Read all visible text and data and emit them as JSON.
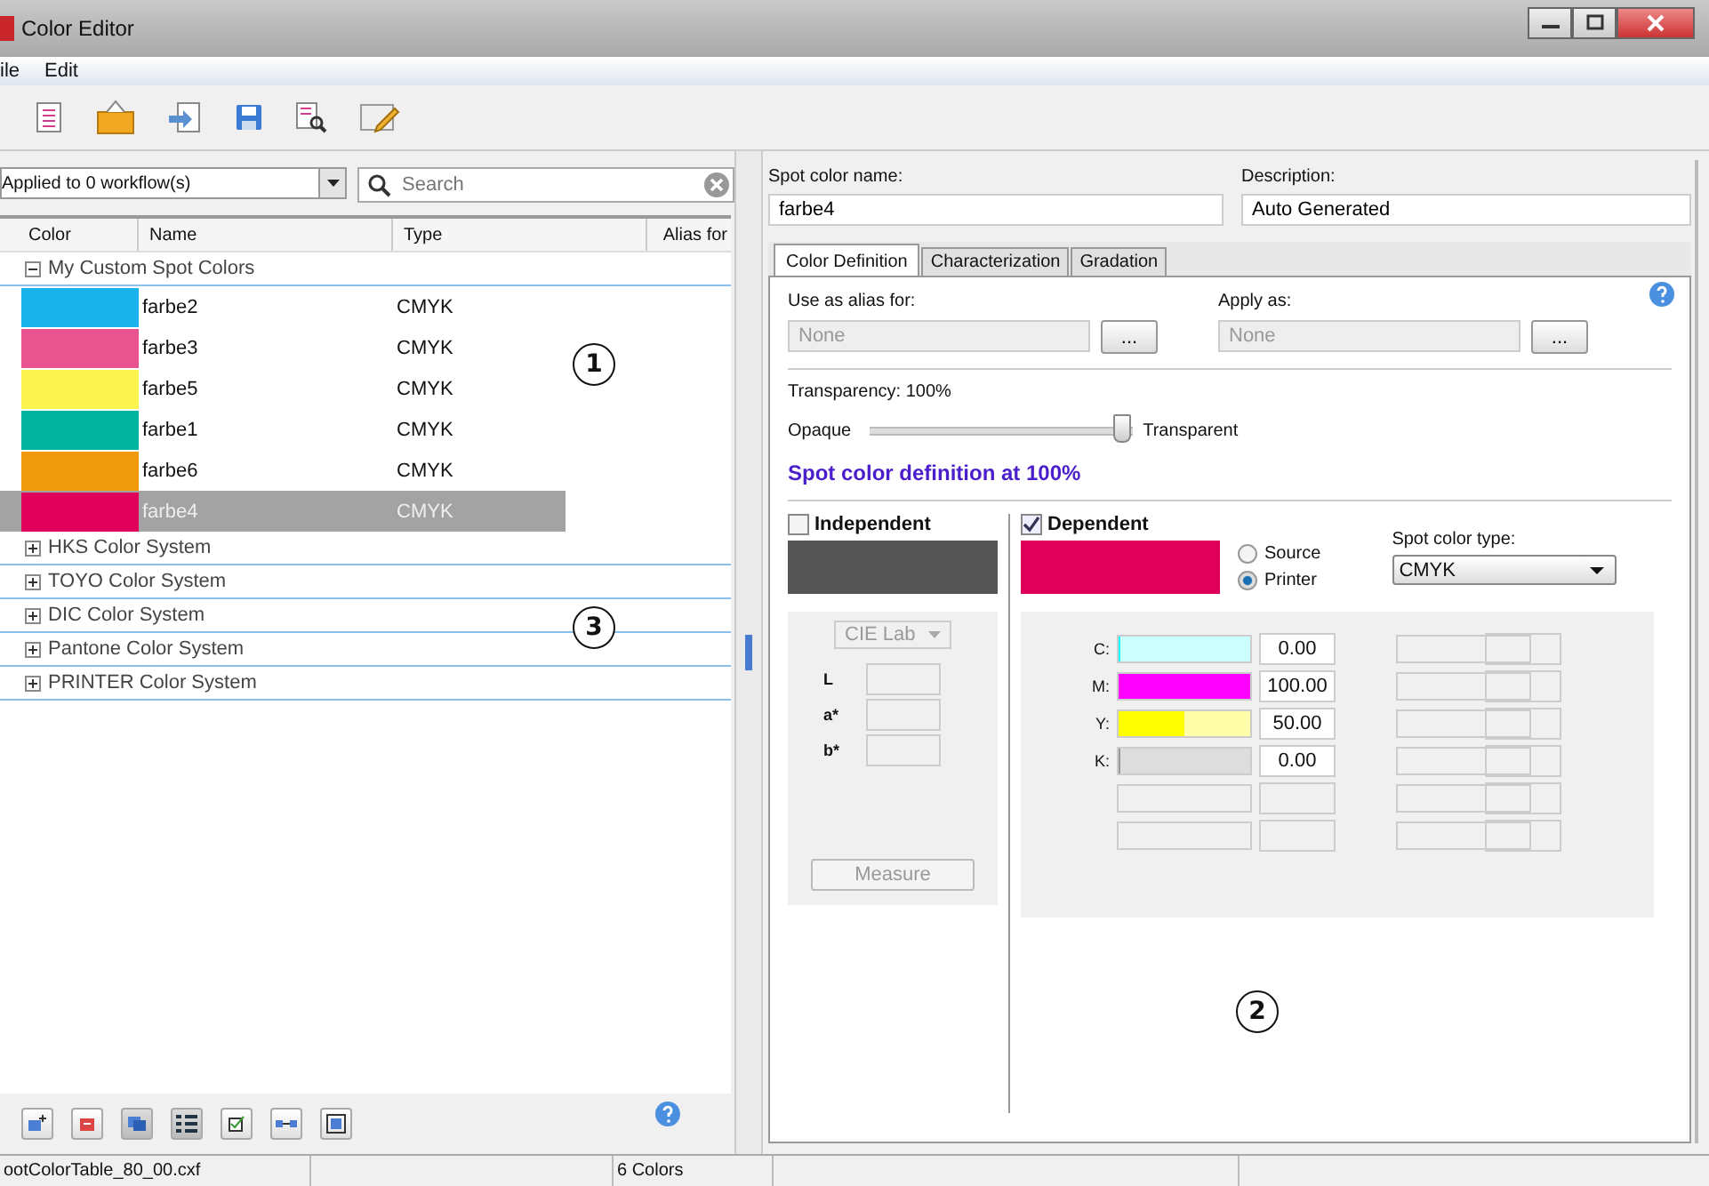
{
  "window": {
    "title": "Color Editor"
  },
  "menu": [
    "ile",
    "Edit"
  ],
  "workflow_dropdown": {
    "value": "Applied to 0 workflow(s)"
  },
  "search": {
    "placeholder": "Search"
  },
  "table": {
    "columns": [
      "Color",
      "Name",
      "Type",
      "Alias for"
    ],
    "groups": [
      {
        "label": "My Custom Spot Colors",
        "expanded": true,
        "rows": [
          {
            "name": "farbe2",
            "type": "CMYK",
            "color": "#1ab3ec",
            "selected": false
          },
          {
            "name": "farbe3",
            "type": "CMYK",
            "color": "#e9548e",
            "selected": false
          },
          {
            "name": "farbe5",
            "type": "CMYK",
            "color": "#fbf44f",
            "selected": false
          },
          {
            "name": "farbe1",
            "type": "CMYK",
            "color": "#00b4a0",
            "selected": false
          },
          {
            "name": "farbe6",
            "type": "CMYK",
            "color": "#ef9a0a",
            "selected": false
          },
          {
            "name": "farbe4",
            "type": "CMYK",
            "color": "#e0005a",
            "selected": true
          }
        ]
      },
      {
        "label": "HKS Color System",
        "expanded": false
      },
      {
        "label": "TOYO Color System",
        "expanded": false
      },
      {
        "label": "DIC Color System",
        "expanded": false
      },
      {
        "label": "Pantone Color System",
        "expanded": false
      },
      {
        "label": "PRINTER Color System",
        "expanded": false
      }
    ]
  },
  "spot_name": {
    "label": "Spot color name:",
    "value": "farbe4"
  },
  "description": {
    "label": "Description:",
    "value": "Auto Generated"
  },
  "tabs": [
    {
      "label": "Color Definition",
      "selected": true
    },
    {
      "label": "Characterization",
      "selected": false
    },
    {
      "label": "Gradation",
      "selected": false
    }
  ],
  "alias": {
    "label": "Use as alias for:",
    "value": "None",
    "button": "..."
  },
  "apply_as": {
    "label": "Apply as:",
    "value": "None",
    "button": "..."
  },
  "transparency": {
    "label": "Transparency:  100%",
    "left": "Opaque",
    "right": "Transparent",
    "level": 0.97
  },
  "definition_heading": "Spot color definition at 100%",
  "independent": {
    "label": "Independent",
    "checked": false,
    "model": "CIE Lab",
    "fields": [
      "L",
      "a*",
      "b*"
    ],
    "measure": "Measure"
  },
  "dependent": {
    "label": "Dependent",
    "checked": true,
    "radios": [
      {
        "label": "Source",
        "selected": false
      },
      {
        "label": "Printer",
        "selected": true
      }
    ],
    "spot_type": {
      "label": "Spot color type:",
      "value": "CMYK"
    },
    "inks": [
      {
        "label": "C:",
        "value": "0.00",
        "level": 0
      },
      {
        "label": "M:",
        "value": "100.00",
        "level": 1
      },
      {
        "label": "Y:",
        "value": "50.00",
        "level": 0.5
      },
      {
        "label": "K:",
        "value": "0.00",
        "level": 0
      }
    ]
  },
  "callouts": [
    "1",
    "2",
    "3"
  ],
  "status_bar": {
    "file": "ootColorTable_80_00.cxf",
    "count": "6 Colors"
  }
}
